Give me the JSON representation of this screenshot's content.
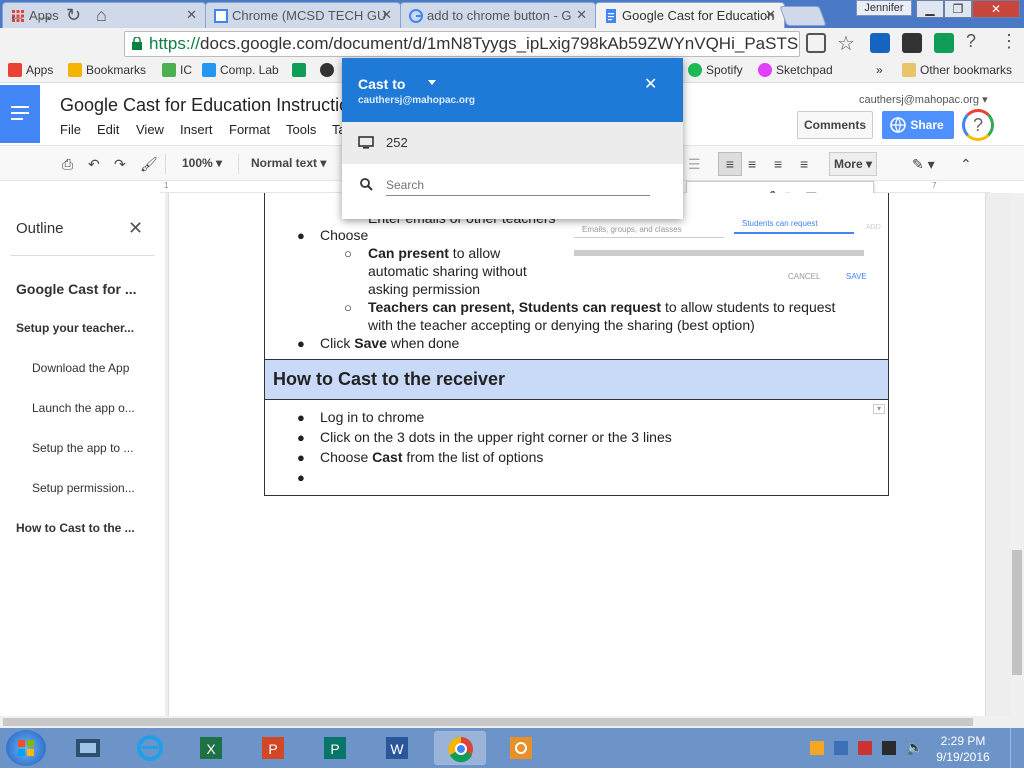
{
  "browser": {
    "tabs": [
      {
        "title": "Apps",
        "active": false
      },
      {
        "title": "Chrome (MCSD TECH GU",
        "active": false
      },
      {
        "title": "add to chrome button - G",
        "active": false
      },
      {
        "title": "Google Cast for Education",
        "active": true
      }
    ],
    "profile_name": "Jennifer",
    "url_scheme": "https://",
    "url_rest": "docs.google.com/document/d/1mN8Tyygs_ipLxig798kAb59ZWYnVQHi_PaSTSBKiUal",
    "bookmarks": [
      {
        "label": "Apps",
        "color": "#e94235"
      },
      {
        "label": "Bookmarks",
        "color": "#f5b400"
      },
      {
        "label": "IC",
        "color": "#4caf50"
      },
      {
        "label": "Comp. Lab",
        "color": "#2196f3"
      },
      {
        "label": "",
        "color": "#0f9d58"
      },
      {
        "label": "",
        "color": "#333333"
      },
      {
        "label": "Spotify",
        "color": "#1db954"
      },
      {
        "label": "Sketchpad",
        "color": "#e040fb"
      }
    ],
    "bookmarks_more": "»",
    "other_bookmarks": "Other bookmarks"
  },
  "docs": {
    "title": "Google Cast for Education Instructions",
    "menu": [
      "File",
      "Edit",
      "View",
      "Insert",
      "Format",
      "Tools",
      "Ta"
    ],
    "user_email": "cauthersj@mahopac.org",
    "comments_label": "Comments",
    "share_label": "Share",
    "avatar_glyph": "?",
    "zoom": "100%",
    "style": "Normal text",
    "more_label": "More",
    "ruler_left": "1",
    "ruler_right": "7"
  },
  "outline": {
    "title": "Outline",
    "items": [
      {
        "label": "Google Cast for ...",
        "level": 0
      },
      {
        "label": "Setup your teacher...",
        "level": 1
      },
      {
        "label": "Download the App",
        "level": 2
      },
      {
        "label": "Launch the app o...",
        "level": 2
      },
      {
        "label": "Setup the app to ...",
        "level": 2
      },
      {
        "label": "Setup permission...",
        "level": 2
      },
      {
        "label": "How to Cast to the ...",
        "level": 1
      }
    ]
  },
  "content": {
    "cut_line": "Enter emails or other teachers",
    "choose": "Choose",
    "sub1_bold": "Can present",
    "sub1_rest_a": "  to allow",
    "sub1_rest_b": "automatic sharing without",
    "sub1_rest_c": "asking permission",
    "sub2_bold": "Teachers can present, Students can request",
    "sub2_rest_a": " to allow students to request",
    "sub2_rest_b": "with the teacher accepting or denying the sharing (best option)",
    "click_pre": "Click ",
    "click_bold": "Save",
    "click_post": " when done",
    "section_heading": "How to Cast to the receiver",
    "step1": "Log in to chrome",
    "step2": "Click on the 3 dots in the upper right corner or the 3 lines",
    "step3_pre": "Choose ",
    "step3_bold": "Cast",
    "step3_post": " from the list of options",
    "frag_input": "Emails, groups, and classes",
    "frag_link": "Students can request",
    "frag_add": "ADD",
    "frag_cancel": "CANCEL",
    "frag_save": "SAVE"
  },
  "cast_popup": {
    "title": "Cast to",
    "email": "cauthersj@mahopac.org",
    "device": "252",
    "search_placeholder": "Search"
  },
  "taskbar": {
    "time": "2:29 PM",
    "date": "9/19/2016"
  }
}
